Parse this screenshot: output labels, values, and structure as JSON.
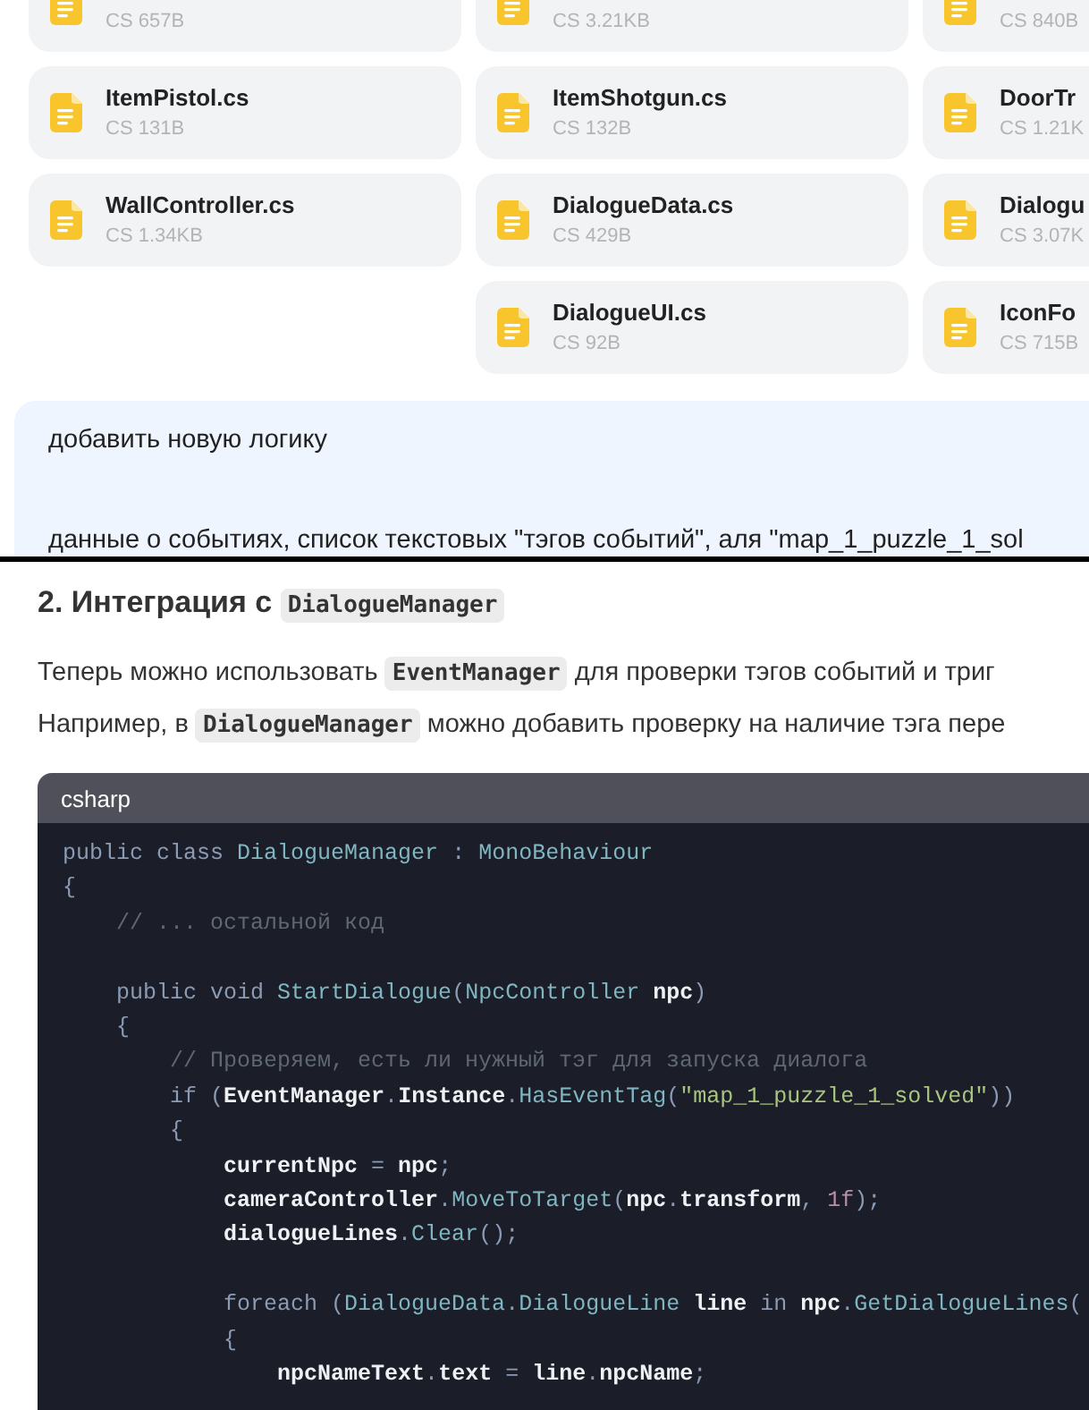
{
  "files": {
    "rows": [
      [
        {
          "size": "CS 657B"
        },
        {
          "size": "CS 3.21KB"
        },
        {
          "size": "CS 840B"
        }
      ],
      [
        {
          "name": "ItemPistol.cs",
          "size": "CS 131B"
        },
        {
          "name": "ItemShotgun.cs",
          "size": "CS 132B"
        },
        {
          "name": "DoorTr",
          "size": "CS 1.21K"
        }
      ],
      [
        {
          "name": "WallController.cs",
          "size": "CS 1.34KB"
        },
        {
          "name": "DialogueData.cs",
          "size": "CS 429B"
        },
        {
          "name": "Dialogu",
          "size": "CS 3.07K"
        }
      ],
      [
        null,
        {
          "name": "DialogueUI.cs",
          "size": "CS 92B"
        },
        {
          "name": "IconFo",
          "size": "CS 715B"
        }
      ]
    ]
  },
  "message": {
    "paragraphs": [
      "добавить новую логику",
      "данные о событиях, список текстовых \"тэгов событий\", аля \"map_1_puzzle_1_sol"
    ]
  },
  "answer": {
    "heading": [
      {
        "text": "2. Интеграция с ",
        "code": false
      },
      {
        "text": "DialogueManager",
        "code": true
      }
    ],
    "paragraph_lines": [
      [
        {
          "text": "Теперь можно использовать ",
          "code": false
        },
        {
          "text": "EventManager",
          "code": true
        },
        {
          "text": " для проверки тэгов событий и триг",
          "code": false
        }
      ],
      [
        {
          "text": "Например, в ",
          "code": false
        },
        {
          "text": "DialogueManager",
          "code": true
        },
        {
          "text": " можно добавить проверку на наличие тэга пере",
          "code": false
        }
      ]
    ],
    "code_block": {
      "language": "csharp",
      "lines": [
        {
          "kind": "code",
          "tokens": [
            {
              "kind": "keyword",
              "text": "public class "
            },
            {
              "kind": "type",
              "text": "DialogueManager"
            },
            {
              "kind": "punct",
              "text": " : "
            },
            {
              "kind": "type",
              "text": "MonoBehaviour"
            }
          ]
        },
        {
          "kind": "code",
          "tokens": [
            {
              "kind": "punct",
              "text": "{"
            }
          ]
        },
        {
          "kind": "code",
          "tokens": [
            {
              "kind": "comment",
              "text": "    // ... остальной код"
            }
          ]
        },
        {
          "kind": "blank"
        },
        {
          "kind": "code",
          "tokens": [
            {
              "kind": "keyword",
              "text": "    public void "
            },
            {
              "kind": "function",
              "text": "StartDialogue"
            },
            {
              "kind": "punct",
              "text": "("
            },
            {
              "kind": "type",
              "text": "NpcController "
            },
            {
              "kind": "ident",
              "text": "npc"
            },
            {
              "kind": "punct",
              "text": ")"
            }
          ]
        },
        {
          "kind": "code",
          "tokens": [
            {
              "kind": "punct",
              "text": "    {"
            }
          ]
        },
        {
          "kind": "code",
          "tokens": [
            {
              "kind": "comment",
              "text": "        // Проверяем, есть ли нужный тэг для запуска диалога"
            }
          ]
        },
        {
          "kind": "code",
          "tokens": [
            {
              "kind": "keyword",
              "text": "        if "
            },
            {
              "kind": "punct",
              "text": "("
            },
            {
              "kind": "ident",
              "text": "EventManager"
            },
            {
              "kind": "punct",
              "text": "."
            },
            {
              "kind": "ident",
              "text": "Instance"
            },
            {
              "kind": "punct",
              "text": "."
            },
            {
              "kind": "function",
              "text": "HasEventTag"
            },
            {
              "kind": "punct",
              "text": "("
            },
            {
              "kind": "string",
              "text": "\"map_1_puzzle_1_solved\""
            },
            {
              "kind": "punct",
              "text": "))"
            }
          ]
        },
        {
          "kind": "code",
          "tokens": [
            {
              "kind": "punct",
              "text": "        {"
            }
          ]
        },
        {
          "kind": "code",
          "tokens": [
            {
              "kind": "ident",
              "text": "            currentNpc "
            },
            {
              "kind": "punct",
              "text": "= "
            },
            {
              "kind": "ident",
              "text": "npc"
            },
            {
              "kind": "punct",
              "text": ";"
            }
          ]
        },
        {
          "kind": "code",
          "tokens": [
            {
              "kind": "ident",
              "text": "            cameraController"
            },
            {
              "kind": "punct",
              "text": "."
            },
            {
              "kind": "function",
              "text": "MoveToTarget"
            },
            {
              "kind": "punct",
              "text": "("
            },
            {
              "kind": "ident",
              "text": "npc"
            },
            {
              "kind": "punct",
              "text": "."
            },
            {
              "kind": "ident",
              "text": "transform"
            },
            {
              "kind": "punct",
              "text": ", "
            },
            {
              "kind": "number",
              "text": "1f"
            },
            {
              "kind": "punct",
              "text": ");"
            }
          ]
        },
        {
          "kind": "code",
          "tokens": [
            {
              "kind": "ident",
              "text": "            dialogueLines"
            },
            {
              "kind": "punct",
              "text": "."
            },
            {
              "kind": "function",
              "text": "Clear"
            },
            {
              "kind": "punct",
              "text": "();"
            }
          ]
        },
        {
          "kind": "blank"
        },
        {
          "kind": "code",
          "tokens": [
            {
              "kind": "keyword",
              "text": "            foreach "
            },
            {
              "kind": "punct",
              "text": "("
            },
            {
              "kind": "type",
              "text": "DialogueData"
            },
            {
              "kind": "punct",
              "text": "."
            },
            {
              "kind": "type",
              "text": "DialogueLine "
            },
            {
              "kind": "ident",
              "text": "line "
            },
            {
              "kind": "keyword",
              "text": "in "
            },
            {
              "kind": "ident",
              "text": "npc"
            },
            {
              "kind": "punct",
              "text": "."
            },
            {
              "kind": "function",
              "text": "GetDialogueLines"
            },
            {
              "kind": "punct",
              "text": "("
            }
          ]
        },
        {
          "kind": "code",
          "tokens": [
            {
              "kind": "punct",
              "text": "            {"
            }
          ]
        },
        {
          "kind": "code",
          "tokens": [
            {
              "kind": "ident",
              "text": "                npcNameText"
            },
            {
              "kind": "punct",
              "text": "."
            },
            {
              "kind": "ident",
              "text": "text "
            },
            {
              "kind": "punct",
              "text": "= "
            },
            {
              "kind": "ident",
              "text": "line"
            },
            {
              "kind": "punct",
              "text": "."
            },
            {
              "kind": "ident",
              "text": "npcName"
            },
            {
              "kind": "punct",
              "text": ";"
            }
          ]
        }
      ]
    }
  }
}
